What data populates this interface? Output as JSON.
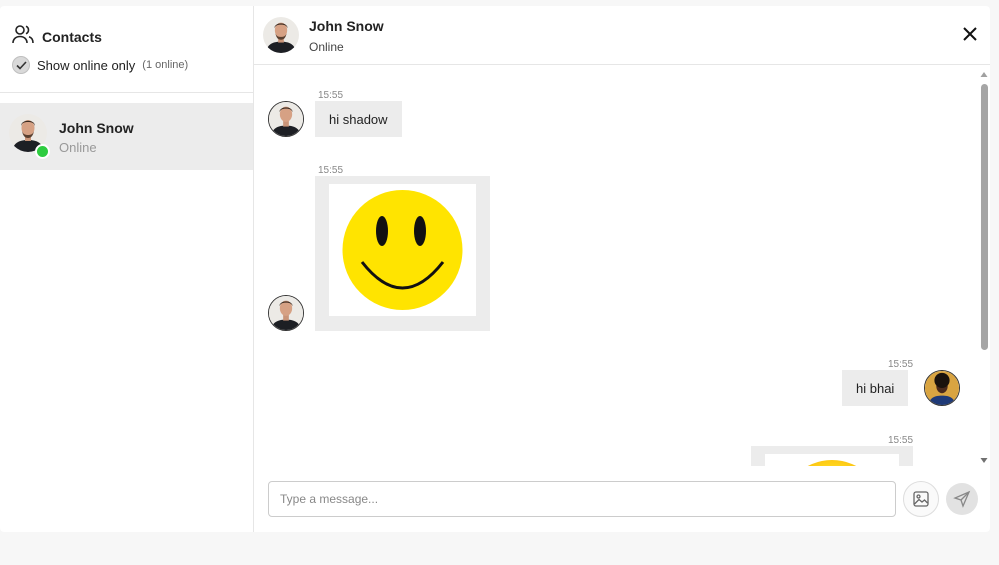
{
  "sidebar": {
    "title": "Contacts",
    "filter_label": "Show online only",
    "filter_count": "(1 online)",
    "filter_checked": true,
    "contacts": [
      {
        "name": "John Snow",
        "status": "Online"
      }
    ]
  },
  "chat": {
    "name": "John Snow",
    "status": "Online",
    "messages": [
      {
        "time": "15:55",
        "text": "hi shadow",
        "from": "contact"
      },
      {
        "time": "15:55",
        "image": "smiley-face",
        "from": "contact"
      },
      {
        "time": "15:55",
        "text": "hi bhai",
        "from": "me"
      },
      {
        "time": "15:55",
        "image": "smiley-face",
        "from": "me"
      }
    ],
    "input_placeholder": "Type a message..."
  },
  "colors": {
    "online": "#2ecc40",
    "bubble": "#ececec",
    "smiley": "#ffe400"
  }
}
